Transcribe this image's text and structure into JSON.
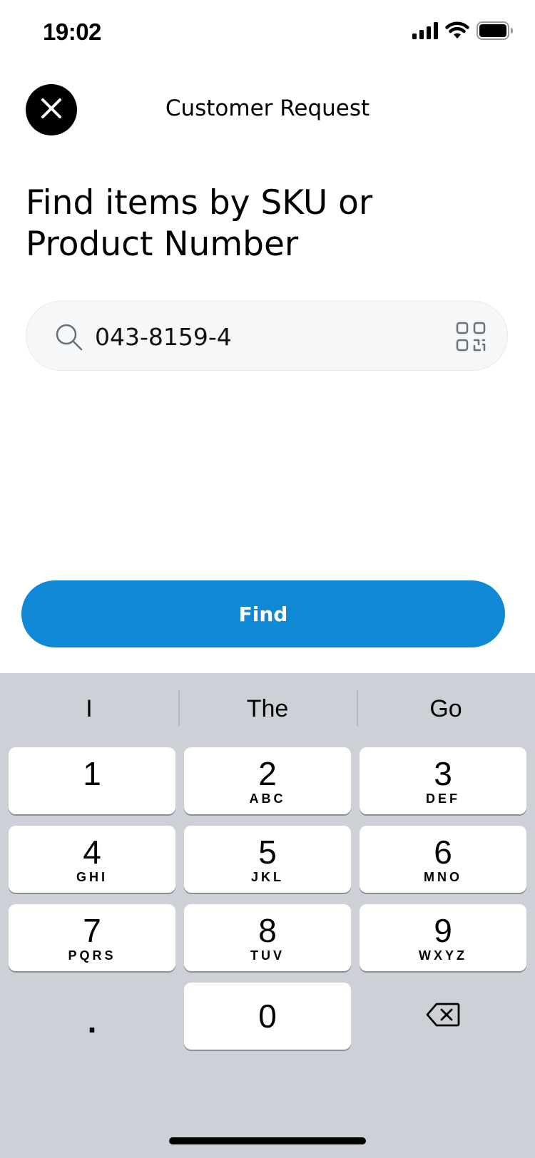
{
  "status_bar": {
    "time": "19:02",
    "icons": [
      "signal-icon",
      "wifi-icon",
      "battery-icon"
    ]
  },
  "header": {
    "title": "Customer Request",
    "close_icon": "close-icon"
  },
  "page": {
    "title_line1": "Find items by SKU or",
    "title_line2": "Product Number"
  },
  "search": {
    "value": "043-8159-4",
    "placeholder": "",
    "icon": "search-icon",
    "scan_icon": "qr-code-icon"
  },
  "actions": {
    "find_label": "Find"
  },
  "colors": {
    "accent": "#0f88d6",
    "keyboard_bg": "#cdd0d6"
  },
  "keyboard": {
    "suggestions": [
      "I",
      "The",
      "Go"
    ],
    "keys": [
      {
        "digit": "1",
        "letters": ""
      },
      {
        "digit": "2",
        "letters": "ABC"
      },
      {
        "digit": "3",
        "letters": "DEF"
      },
      {
        "digit": "4",
        "letters": "GHI"
      },
      {
        "digit": "5",
        "letters": "JKL"
      },
      {
        "digit": "6",
        "letters": "MNO"
      },
      {
        "digit": "7",
        "letters": "PQRS"
      },
      {
        "digit": "8",
        "letters": "TUV"
      },
      {
        "digit": "9",
        "letters": "WXYZ"
      }
    ],
    "dot": ".",
    "zero": "0",
    "delete_icon": "backspace-icon"
  }
}
